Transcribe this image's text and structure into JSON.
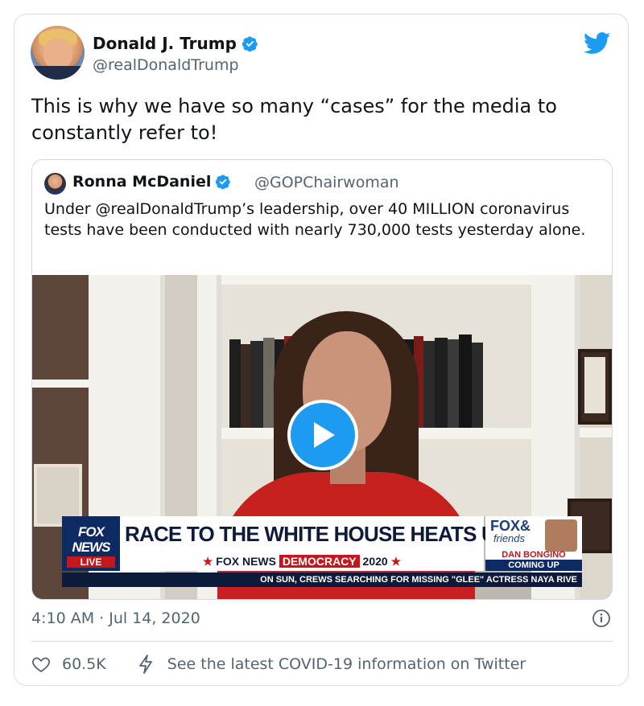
{
  "author": {
    "name": "Donald J. Trump",
    "handle": "@realDonaldTrump"
  },
  "tweet": {
    "text": "This is why we have so many “cases” for the media to constantly refer to!",
    "timestamp": "4:10 AM · Jul 14, 2020"
  },
  "quoted": {
    "name": "Ronna McDaniel",
    "handle": "@GOPChairwoman",
    "text": "Under @realDonaldTrump’s leadership, over 40 MILLION coronavirus tests have been conducted with nearly 730,000 tests yesterday alone."
  },
  "video": {
    "logo_line1": "FOX",
    "logo_line2": "NEWS",
    "logo_live": "LIVE",
    "headline": "RACE TO THE WHITE HOUSE HEATS UP",
    "sub_star_left": "★",
    "sub_brand": "FOX NEWS",
    "sub_democracy": "DEMOCRACY",
    "sub_year": "2020",
    "sub_star_right": "★",
    "show_line1": "FOX&",
    "show_line2": "friends",
    "host": "DAN BONGINO",
    "coming_up": "COMING UP",
    "ticker": "ON SUN, CREWS SEARCHING FOR MISSING \"GLEE\" ACTRESS NAYA RIVE"
  },
  "actions": {
    "likes": "60.5K",
    "covid_link": "See the latest COVID-19 information on Twitter"
  },
  "colors": {
    "twitter_blue": "#1d9bf0",
    "secondary_text": "#536471",
    "border": "#cfd9de"
  },
  "icons": {
    "verified": "verified-badge-icon",
    "brand": "twitter-bird-icon",
    "play": "play-icon",
    "info": "info-icon",
    "like": "heart-icon",
    "covid": "bolt-icon"
  }
}
